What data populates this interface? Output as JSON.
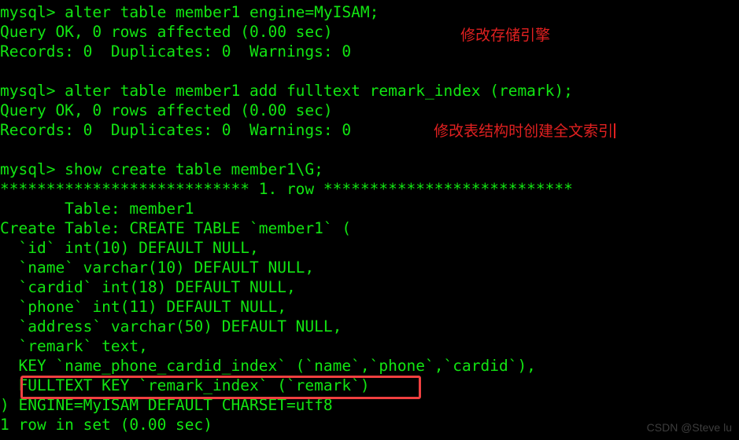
{
  "terminal": {
    "background_color": "#000000",
    "text_color": "#12e512",
    "annotation_color": "#e02020",
    "highlight_border_color": "#f04040",
    "lines": [
      "mysql> alter table member1 engine=MyISAM;",
      "Query OK, 0 rows affected (0.00 sec)",
      "Records: 0  Duplicates: 0  Warnings: 0",
      "",
      "mysql> alter table member1 add fulltext remark_index (remark);",
      "Query OK, 0 rows affected (0.00 sec)",
      "Records: 0  Duplicates: 0  Warnings: 0",
      "",
      "mysql> show create table member1\\G;",
      "*************************** 1. row ***************************",
      "       Table: member1",
      "Create Table: CREATE TABLE `member1` (",
      "  `id` int(10) DEFAULT NULL,",
      "  `name` varchar(10) DEFAULT NULL,",
      "  `cardid` int(18) DEFAULT NULL,",
      "  `phone` int(11) DEFAULT NULL,",
      "  `address` varchar(50) DEFAULT NULL,",
      "  `remark` text,",
      "  KEY `name_phone_cardid_index` (`name`,`phone`,`cardid`),",
      "  FULLTEXT KEY `remark_index` (`remark`)",
      ") ENGINE=MyISAM DEFAULT CHARSET=utf8",
      "1 row in set (0.00 sec)"
    ]
  },
  "annotations": {
    "engine": "修改存储引擎",
    "fulltext": "修改表结构时创建全文索引"
  },
  "watermark": {
    "text": "CSDN @Steve lu"
  }
}
